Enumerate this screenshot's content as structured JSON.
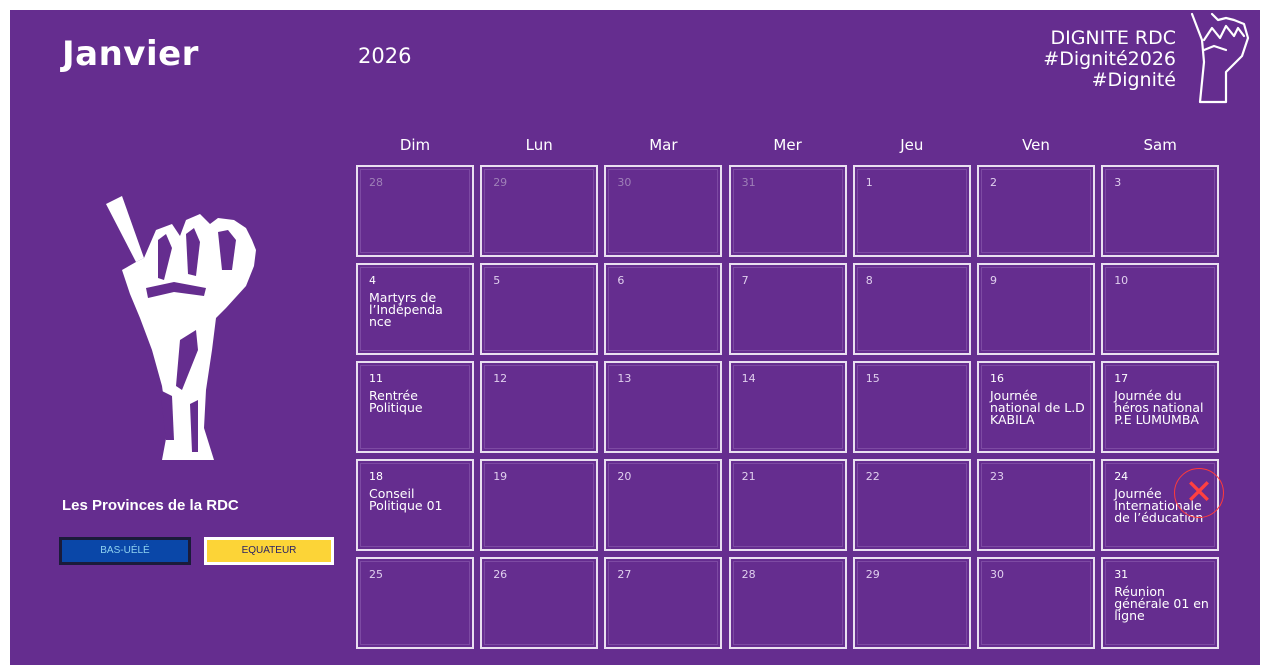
{
  "header": {
    "month": "Janvier",
    "year": "2026",
    "brand_lines": [
      "DIGNITE RDC",
      "#Dignité2026",
      "#Dignité"
    ]
  },
  "weekdays": [
    "Dim",
    "Lun",
    "Mar",
    "Mer",
    "Jeu",
    "Ven",
    "Sam"
  ],
  "weeks": [
    [
      {
        "day": "28"
      },
      {
        "day": "29"
      },
      {
        "day": "30"
      },
      {
        "day": "31"
      },
      {
        "day": "1"
      },
      {
        "day": "2"
      },
      {
        "day": "3"
      }
    ],
    [
      {
        "day": "4",
        "event": "Martyrs de l’Indépenda nce"
      },
      {
        "day": "5"
      },
      {
        "day": "6"
      },
      {
        "day": "7"
      },
      {
        "day": "8"
      },
      {
        "day": "9"
      },
      {
        "day": "10"
      }
    ],
    [
      {
        "day": "11",
        "event": "Rentrée Politique"
      },
      {
        "day": "12"
      },
      {
        "day": "13"
      },
      {
        "day": "14"
      },
      {
        "day": "15"
      },
      {
        "day": "16",
        "event": "Journée national de L.D KABILA"
      },
      {
        "day": "17",
        "event": "Journée du héros national P.E LUMUMBA"
      }
    ],
    [
      {
        "day": "18",
        "event": "Conseil Politique 01"
      },
      {
        "day": "19"
      },
      {
        "day": "20"
      },
      {
        "day": "21"
      },
      {
        "day": "22"
      },
      {
        "day": "23"
      },
      {
        "day": "24",
        "event": "Journée Internationale de l’éducation"
      }
    ],
    [
      {
        "day": "25"
      },
      {
        "day": "26"
      },
      {
        "day": "27"
      },
      {
        "day": "28"
      },
      {
        "day": "29"
      },
      {
        "day": "30"
      },
      {
        "day": "31",
        "event": "Réunion générale 01 en ligne"
      }
    ]
  ],
  "sidebar": {
    "provinces_title": "Les Provinces de la RDC",
    "provinces": [
      {
        "label": "BAS-UÉLÉ",
        "color": "#0a47a8"
      },
      {
        "label": "EQUATEUR",
        "color": "#fcd437"
      }
    ]
  },
  "theme": {
    "background": "#652d8f",
    "text": "#ffffff",
    "close_mark": "#ff3a3a"
  },
  "icons": {
    "header_icon": "raised-fist-icon",
    "illustration": "raised-fist-icon",
    "overlay": "close-icon"
  }
}
